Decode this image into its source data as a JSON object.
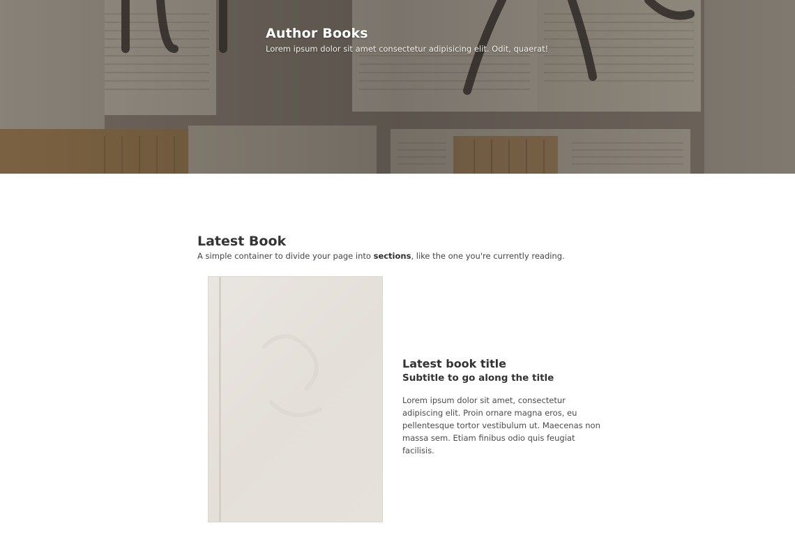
{
  "hero": {
    "title": "Author Books",
    "subtitle": "Lorem ipsum dolor sit amet consectetur adipisicing elit. Odit, quaerat!"
  },
  "section": {
    "title": "Latest Book",
    "desc_before": "A simple container to divide your page into ",
    "desc_bold": "sections",
    "desc_after": ", like the one you're currently reading."
  },
  "book": {
    "title": "Latest book title",
    "subtitle": "Subtitle to go along the title",
    "description": "Lorem ipsum dolor sit amet, consectetur adipiscing elit. Proin ornare magna eros, eu pellentesque tortor vestibulum ut. Maecenas non massa sem. Etiam finibus odio quis feugiat facilisis."
  },
  "colors": {
    "hero_overlay": "#3a342e",
    "cover": "#e6e1db",
    "text": "#3a3a3a"
  }
}
